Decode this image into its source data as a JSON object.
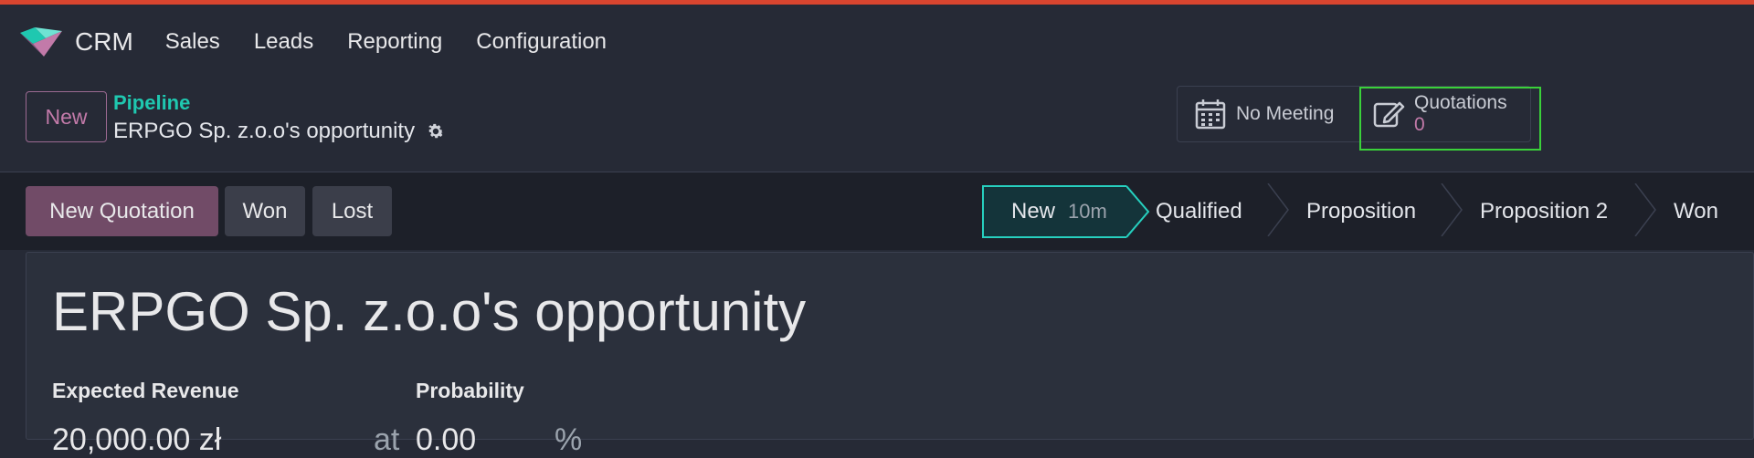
{
  "navbar": {
    "app_name": "CRM",
    "menu": [
      "Sales",
      "Leads",
      "Reporting",
      "Configuration"
    ]
  },
  "control_panel": {
    "new_button": "New",
    "breadcrumb_parent": "Pipeline",
    "record_title": "ERPGO Sp. z.o.o's opportunity",
    "smart_buttons": {
      "meeting_label": "No Meeting",
      "quotations_label": "Quotations",
      "quotations_count": "0"
    }
  },
  "statusbar": {
    "buttons": {
      "new_quotation": "New Quotation",
      "won": "Won",
      "lost": "Lost"
    },
    "stages": [
      {
        "label": "New",
        "duration": "10m",
        "active": true
      },
      {
        "label": "Qualified"
      },
      {
        "label": "Proposition"
      },
      {
        "label": "Proposition 2"
      },
      {
        "label": "Won"
      }
    ]
  },
  "form": {
    "title": "ERPGO Sp. z.o.o's opportunity",
    "expected_revenue_label": "Expected Revenue",
    "expected_revenue_value": "20,000.00 zł",
    "at_label": "at",
    "probability_label": "Probability",
    "probability_value": "0.00",
    "percent_symbol": "%"
  },
  "colors": {
    "accent_top": "#d9452f",
    "primary": "#714b67",
    "teal": "#1fc8b0",
    "highlight": "#3ad13a"
  },
  "icons": {
    "logo": "crm-logo-icon",
    "settings": "gear-icon",
    "meeting": "calendar-icon",
    "quotations": "edit-icon"
  }
}
